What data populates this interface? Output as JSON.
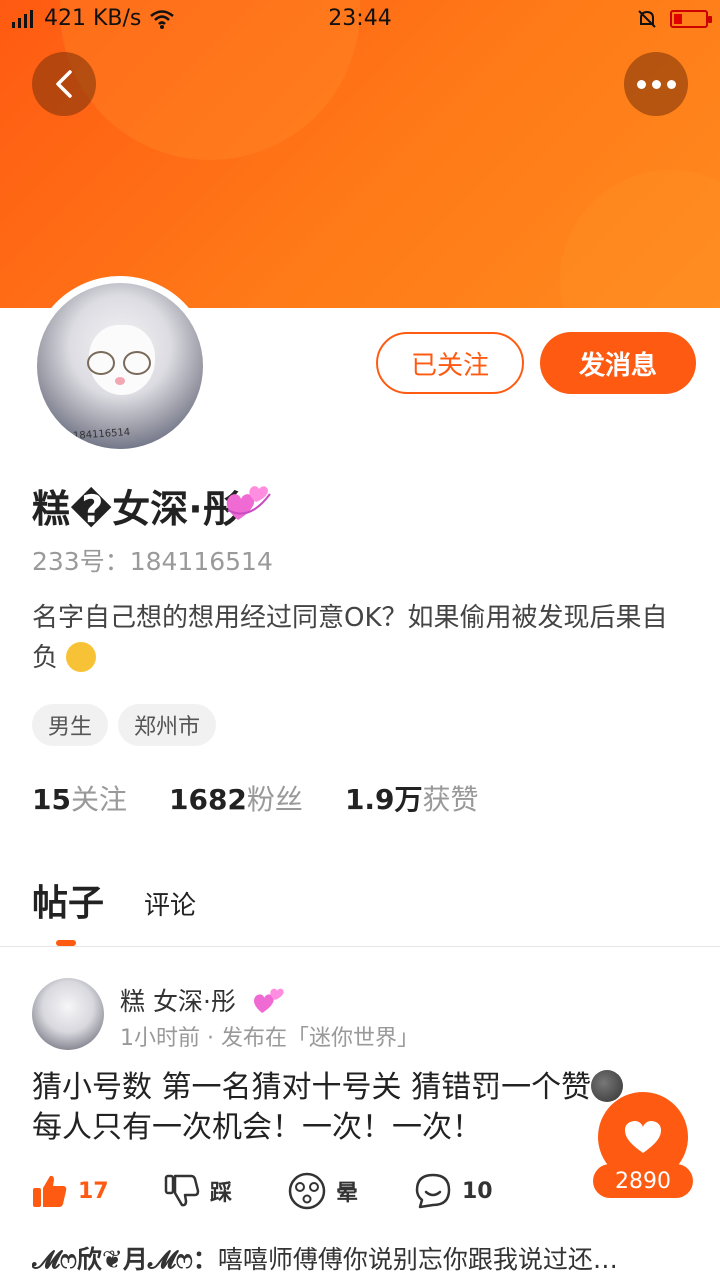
{
  "status_bar": {
    "network_speed": "421 KB/s",
    "time": "23:44",
    "signal_label": "E",
    "battery_level": 0.25,
    "battery_color": "#e00000"
  },
  "header": {
    "back_icon": "chevron-left-icon",
    "more_icon": "more-dots-icon",
    "banner_color": "#ff6a14"
  },
  "profile": {
    "avatar_id_text": "184116514",
    "name": "糕�女深·彤",
    "uid_label": "233号：",
    "uid": "184116514",
    "bio": "名字自己想的想用经过同意OK？如果偷用被发现后果自负",
    "tags": [
      "男生",
      "郑州市"
    ],
    "followed_label": "已关注",
    "message_label": "发消息"
  },
  "stats": [
    {
      "value": "15",
      "label": "关注"
    },
    {
      "value": "1682",
      "label": "粉丝"
    },
    {
      "value": "1.9万",
      "label": "获赞"
    }
  ],
  "tabs": [
    {
      "label": "帖子",
      "active": true
    },
    {
      "label": "评论",
      "active": false
    }
  ],
  "post": {
    "author": "糕  女深·彤",
    "time": "1小时前",
    "published_in": "发布在「迷你世界」",
    "text_line1": "猜小号数 第一名猜对十号关 猜错罚一个赞",
    "text_line2": "每人只有一次机会！一次！一次！",
    "actions": {
      "like_count": "17",
      "dislike_label": "踩",
      "dizzy_label": "晕",
      "comment_count": "10"
    },
    "top_comment": {
      "author": "𝓜ෆ欣❦月𝓜ෆ：",
      "text": "嘻嘻师傅傅你说别忘你跟我说过还…"
    }
  },
  "floating_like": {
    "count": "2890",
    "icon": "heart-icon"
  },
  "accent_color": "#ff5a12"
}
